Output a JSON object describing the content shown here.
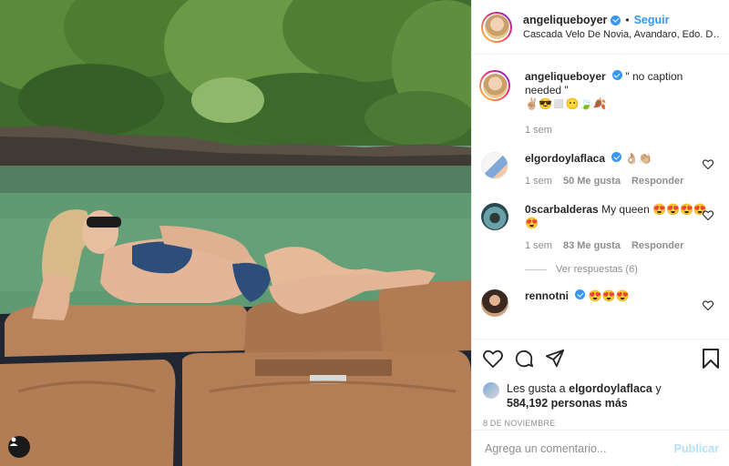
{
  "post": {
    "author": "angeliqueboyer",
    "follow_label": "Seguir",
    "separator": "•",
    "location": "Cascada Velo De Novia, Avandaro, Edo. De...",
    "caption": "\" no caption needed \"",
    "caption_emojis": "✌🏼😎◻️😶🍃🍂",
    "caption_time": "1 sem"
  },
  "comments": [
    {
      "username": "elgordoylaflaca",
      "text": "👌🏼👏🏼",
      "time": "1 sem",
      "likes": "50 Me gusta",
      "reply_label": "Responder"
    },
    {
      "username": "0scarbalderas",
      "text": "My queen 😍😍😍😍😍",
      "time": "1 sem",
      "likes": "83 Me gusta",
      "reply_label": "Responder",
      "replies_label": "Ver respuestas (6)"
    },
    {
      "username": "rennotni",
      "text": "😍😍😍"
    }
  ],
  "likes": {
    "prefix": "Les gusta a",
    "liked_by": "elgordoylaflaca",
    "connector": "y",
    "count": "584,192 personas más"
  },
  "date": "8 DE NOVIEMBRE",
  "add_comment": {
    "placeholder": "Agrega un comentario...",
    "publish_label": "Publicar"
  },
  "icons": {
    "like": "heart-icon",
    "comment": "comment-icon",
    "share": "share-icon",
    "save": "bookmark-icon",
    "user_tags": "user-tag-icon"
  },
  "colors": {
    "accent": "#3897f0",
    "publish_disabled": "#b2dffc",
    "secondary_text": "#8e8e8e"
  }
}
